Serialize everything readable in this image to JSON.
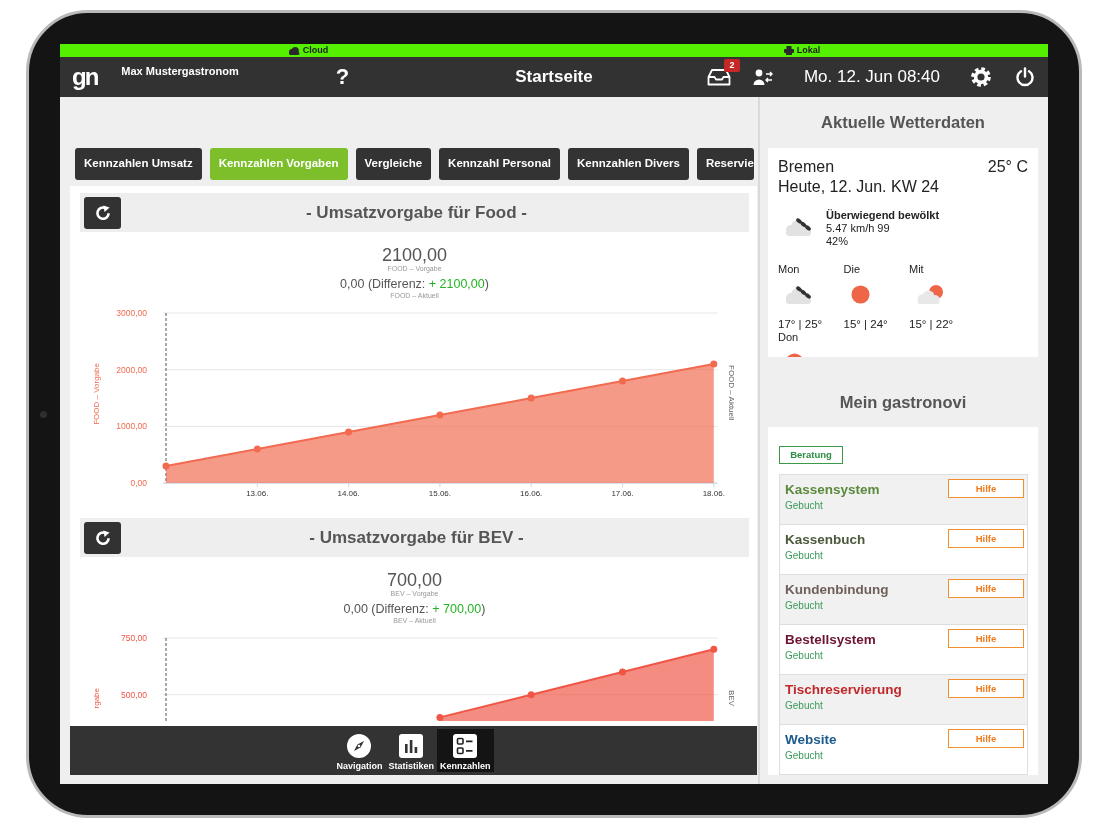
{
  "status_bar": [
    {
      "kind": "cloud",
      "label": "Cloud"
    },
    {
      "kind": "printer",
      "label": "Lokal"
    }
  ],
  "header": {
    "logo": "gn",
    "user": "Max Mustergastronom",
    "help": "?",
    "title": "Startseite",
    "inbox_badge": "2",
    "datetime": "Mo. 12. Jun 08:40"
  },
  "tabs": [
    {
      "label": "Kennzahlen Umsatz",
      "selected": false
    },
    {
      "label": "Kennzahlen Vorgaben",
      "selected": true
    },
    {
      "label": "Vergleiche",
      "selected": false
    },
    {
      "label": "Kennzahl Personal",
      "selected": false
    },
    {
      "label": "Kennzahlen Divers",
      "selected": false
    },
    {
      "label": "Reservie",
      "selected": false
    }
  ],
  "sections": [
    {
      "title": "- Umsatzvorgabe für Food -",
      "target": "2100,00",
      "target_caption": "FOOD – Vorgabe",
      "actual_prefix": "0,00 (Differenz:",
      "difference": "+ 2100,00",
      "actual_suffix": ")",
      "actual_caption": "FOOD – Aktuell",
      "right_axis_label": "FOOD – Aktuell",
      "chart_data": {
        "type": "area",
        "ylabel": "FOOD – Vorgabe",
        "x": [
          12.06,
          13.06,
          14.06,
          15.06,
          16.06,
          17.06,
          18.06
        ],
        "xlim": [
          12.03,
          18.1
        ],
        "ylim": [
          0,
          3000
        ],
        "xticks": [
          {
            "value": 13.06,
            "label": "13.06."
          },
          {
            "value": 14.06,
            "label": "14.06."
          },
          {
            "value": 15.06,
            "label": "15.06."
          },
          {
            "value": 16.06,
            "label": "16.06."
          },
          {
            "value": 17.06,
            "label": "17.06."
          },
          {
            "value": 18.06,
            "label": "18.06."
          }
        ],
        "yticks": [
          {
            "value": 0,
            "label": "0,00"
          },
          {
            "value": 1000,
            "label": "1000,00"
          },
          {
            "value": 2000,
            "label": "2000,00"
          },
          {
            "value": 3000,
            "label": "3000,00"
          }
        ],
        "ref_lines": [
          {
            "axis": "x",
            "value": 12.06
          }
        ],
        "series": [
          {
            "color": "#f26a50",
            "values": [
              300,
              600,
              900,
              1200,
              1500,
              1800,
              2100
            ]
          }
        ]
      }
    },
    {
      "title": "- Umsatzvorgabe für BEV -",
      "target": "700,00",
      "target_caption": "BEV – Vorgabe",
      "actual_prefix": "0,00 (Differenz:",
      "difference": "+ 700,00",
      "actual_suffix": ")",
      "actual_caption": "BEV – Aktuell",
      "right_axis_label": "BEV",
      "chart_picture": {
        "ylabel": "rgabe",
        "ytick_labels": [
          "750,00",
          "500,00"
        ],
        "color": "#f05545"
      }
    }
  ],
  "bottom_nav": [
    {
      "kind": "compass",
      "label": "Navigation",
      "selected": false
    },
    {
      "kind": "bars",
      "label": "Statistiken",
      "selected": false
    },
    {
      "kind": "list",
      "label": "Kennzahlen",
      "selected": true
    }
  ],
  "weather": {
    "heading": "Aktuelle Wetterdaten",
    "city": "Bremen",
    "temperature": "25° C",
    "date": "Heute, 12. Jun. KW 24",
    "current": {
      "kind": "rain-cloud",
      "condition": "Überwiegend bewölkt",
      "wind": "5.47 km/h 99",
      "humidity": "42%"
    },
    "forecast": [
      {
        "day": "Mon",
        "kind": "rain-cloud",
        "temps": "17° | 25°"
      },
      {
        "day": "Die",
        "kind": "sun",
        "temps": "15° | 24°"
      },
      {
        "day": "Mit",
        "kind": "cloud-sun",
        "temps": "15° | 22°"
      },
      {
        "day": "Don",
        "kind": "sun"
      }
    ]
  },
  "gastronovi": {
    "heading": "Mein gastronovi",
    "consult_button": "Beratung",
    "items": [
      {
        "name": "Kassensystem",
        "color": "#5a8a3c",
        "status": "Gebucht",
        "help_button": "Hilfe"
      },
      {
        "name": "Kassenbuch",
        "color": "#4b5a3c",
        "status": "Gebucht",
        "help_button": "Hilfe"
      },
      {
        "name": "Kundenbindung",
        "color": "#6e5f5a",
        "status": "Gebucht",
        "help_button": "Hilfe"
      },
      {
        "name": "Bestellsystem",
        "color": "#6d1530",
        "status": "Gebucht",
        "help_button": "Hilfe"
      },
      {
        "name": "Tischreservierung",
        "color": "#c0282a",
        "status": "Gebucht",
        "help_button": "Hilfe"
      },
      {
        "name": "Website",
        "color": "#1d5a8c",
        "status": "Gebucht",
        "help_button": "Hilfe"
      }
    ]
  }
}
